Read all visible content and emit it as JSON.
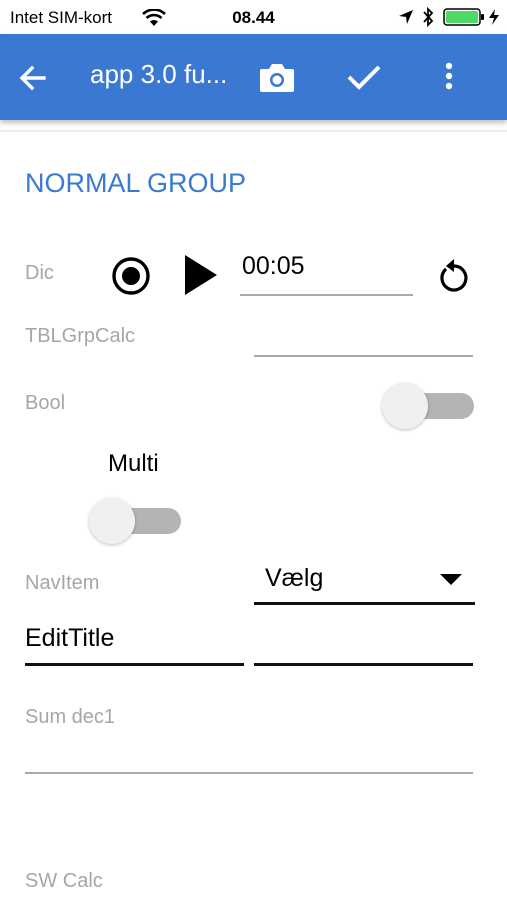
{
  "status_bar": {
    "carrier": "Intet SIM-kort",
    "time": "08.44"
  },
  "app_bar": {
    "title": "app 3.0 fu...",
    "accent_color": "#3a78d1"
  },
  "group": {
    "title": "NORMAL GROUP"
  },
  "fields": {
    "dic_label": "Dic",
    "timer_value": "00:05",
    "tbl_label": "TBLGrpCalc",
    "bool_label": "Bool",
    "multi_label": "Multi",
    "nav_label": "NavItem",
    "nav_value": "Vælg",
    "edit_title": "EditTitle",
    "sum_label": "Sum dec1",
    "sw_label": "SW Calc"
  },
  "toggles": {
    "bool_on": false,
    "multi_on": false
  }
}
